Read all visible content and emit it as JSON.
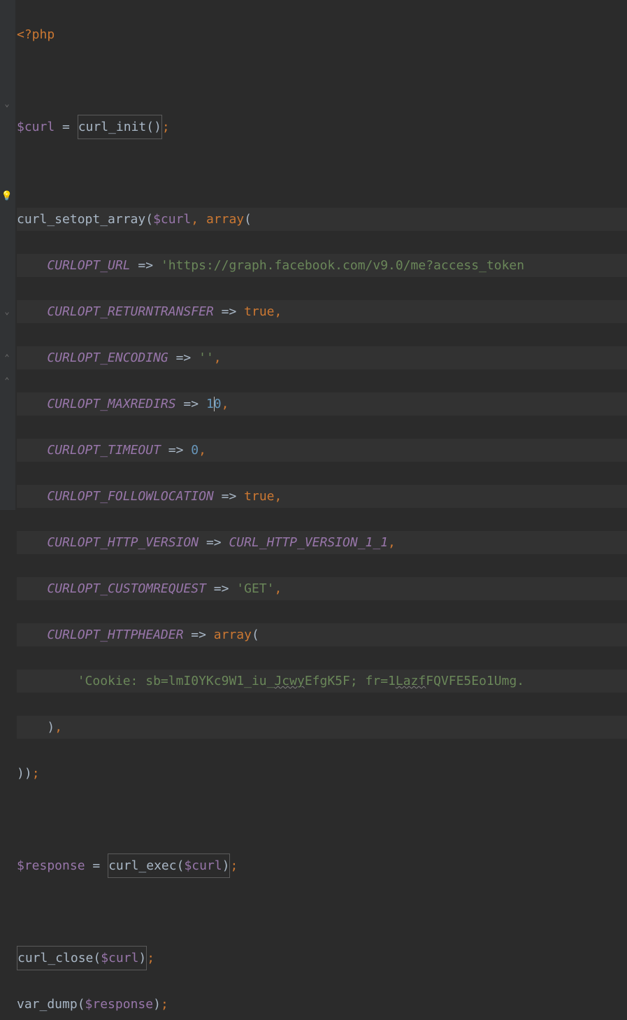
{
  "code": {
    "php_open": "<?php",
    "curl_var": "$curl",
    "assign": " = ",
    "curl_init": "curl_init()",
    "semi": ";",
    "setopt": "curl_setopt_array",
    "array_kw": "array",
    "url": "CURLOPT_URL",
    "url_val": "'https://graph.facebook.com/v9.0/me?access_token",
    "returntransfer": "CURLOPT_RETURNTRANSFER",
    "true": "true",
    "encoding": "CURLOPT_ENCODING",
    "empty_str": "''",
    "maxredirs": "CURLOPT_MAXREDIRS",
    "maxredirs_val1": "1",
    "maxredirs_val2": "0",
    "timeout": "CURLOPT_TIMEOUT",
    "timeout_val": "0",
    "followloc": "CURLOPT_FOLLOWLOCATION",
    "httpver": "CURLOPT_HTTP_VERSION",
    "httpver_val": "CURL_HTTP_VERSION_1_1",
    "customreq": "CURLOPT_CUSTOMREQUEST",
    "get": "'GET'",
    "httpheader": "CURLOPT_HTTPHEADER",
    "cookie_1": "'Cookie: sb=lmI0YKc9W1_iu_",
    "cookie_w1": "Jcwy",
    "cookie_2": "EfgK5F; fr=1",
    "cookie_w2": "Lazf",
    "cookie_3": "FQVFE5Eo1Umg.",
    "response": "$response",
    "curl_exec": "curl_exec",
    "curl_close": "curl_close",
    "var_dump": "var_dump",
    "arrow": " => "
  }
}
